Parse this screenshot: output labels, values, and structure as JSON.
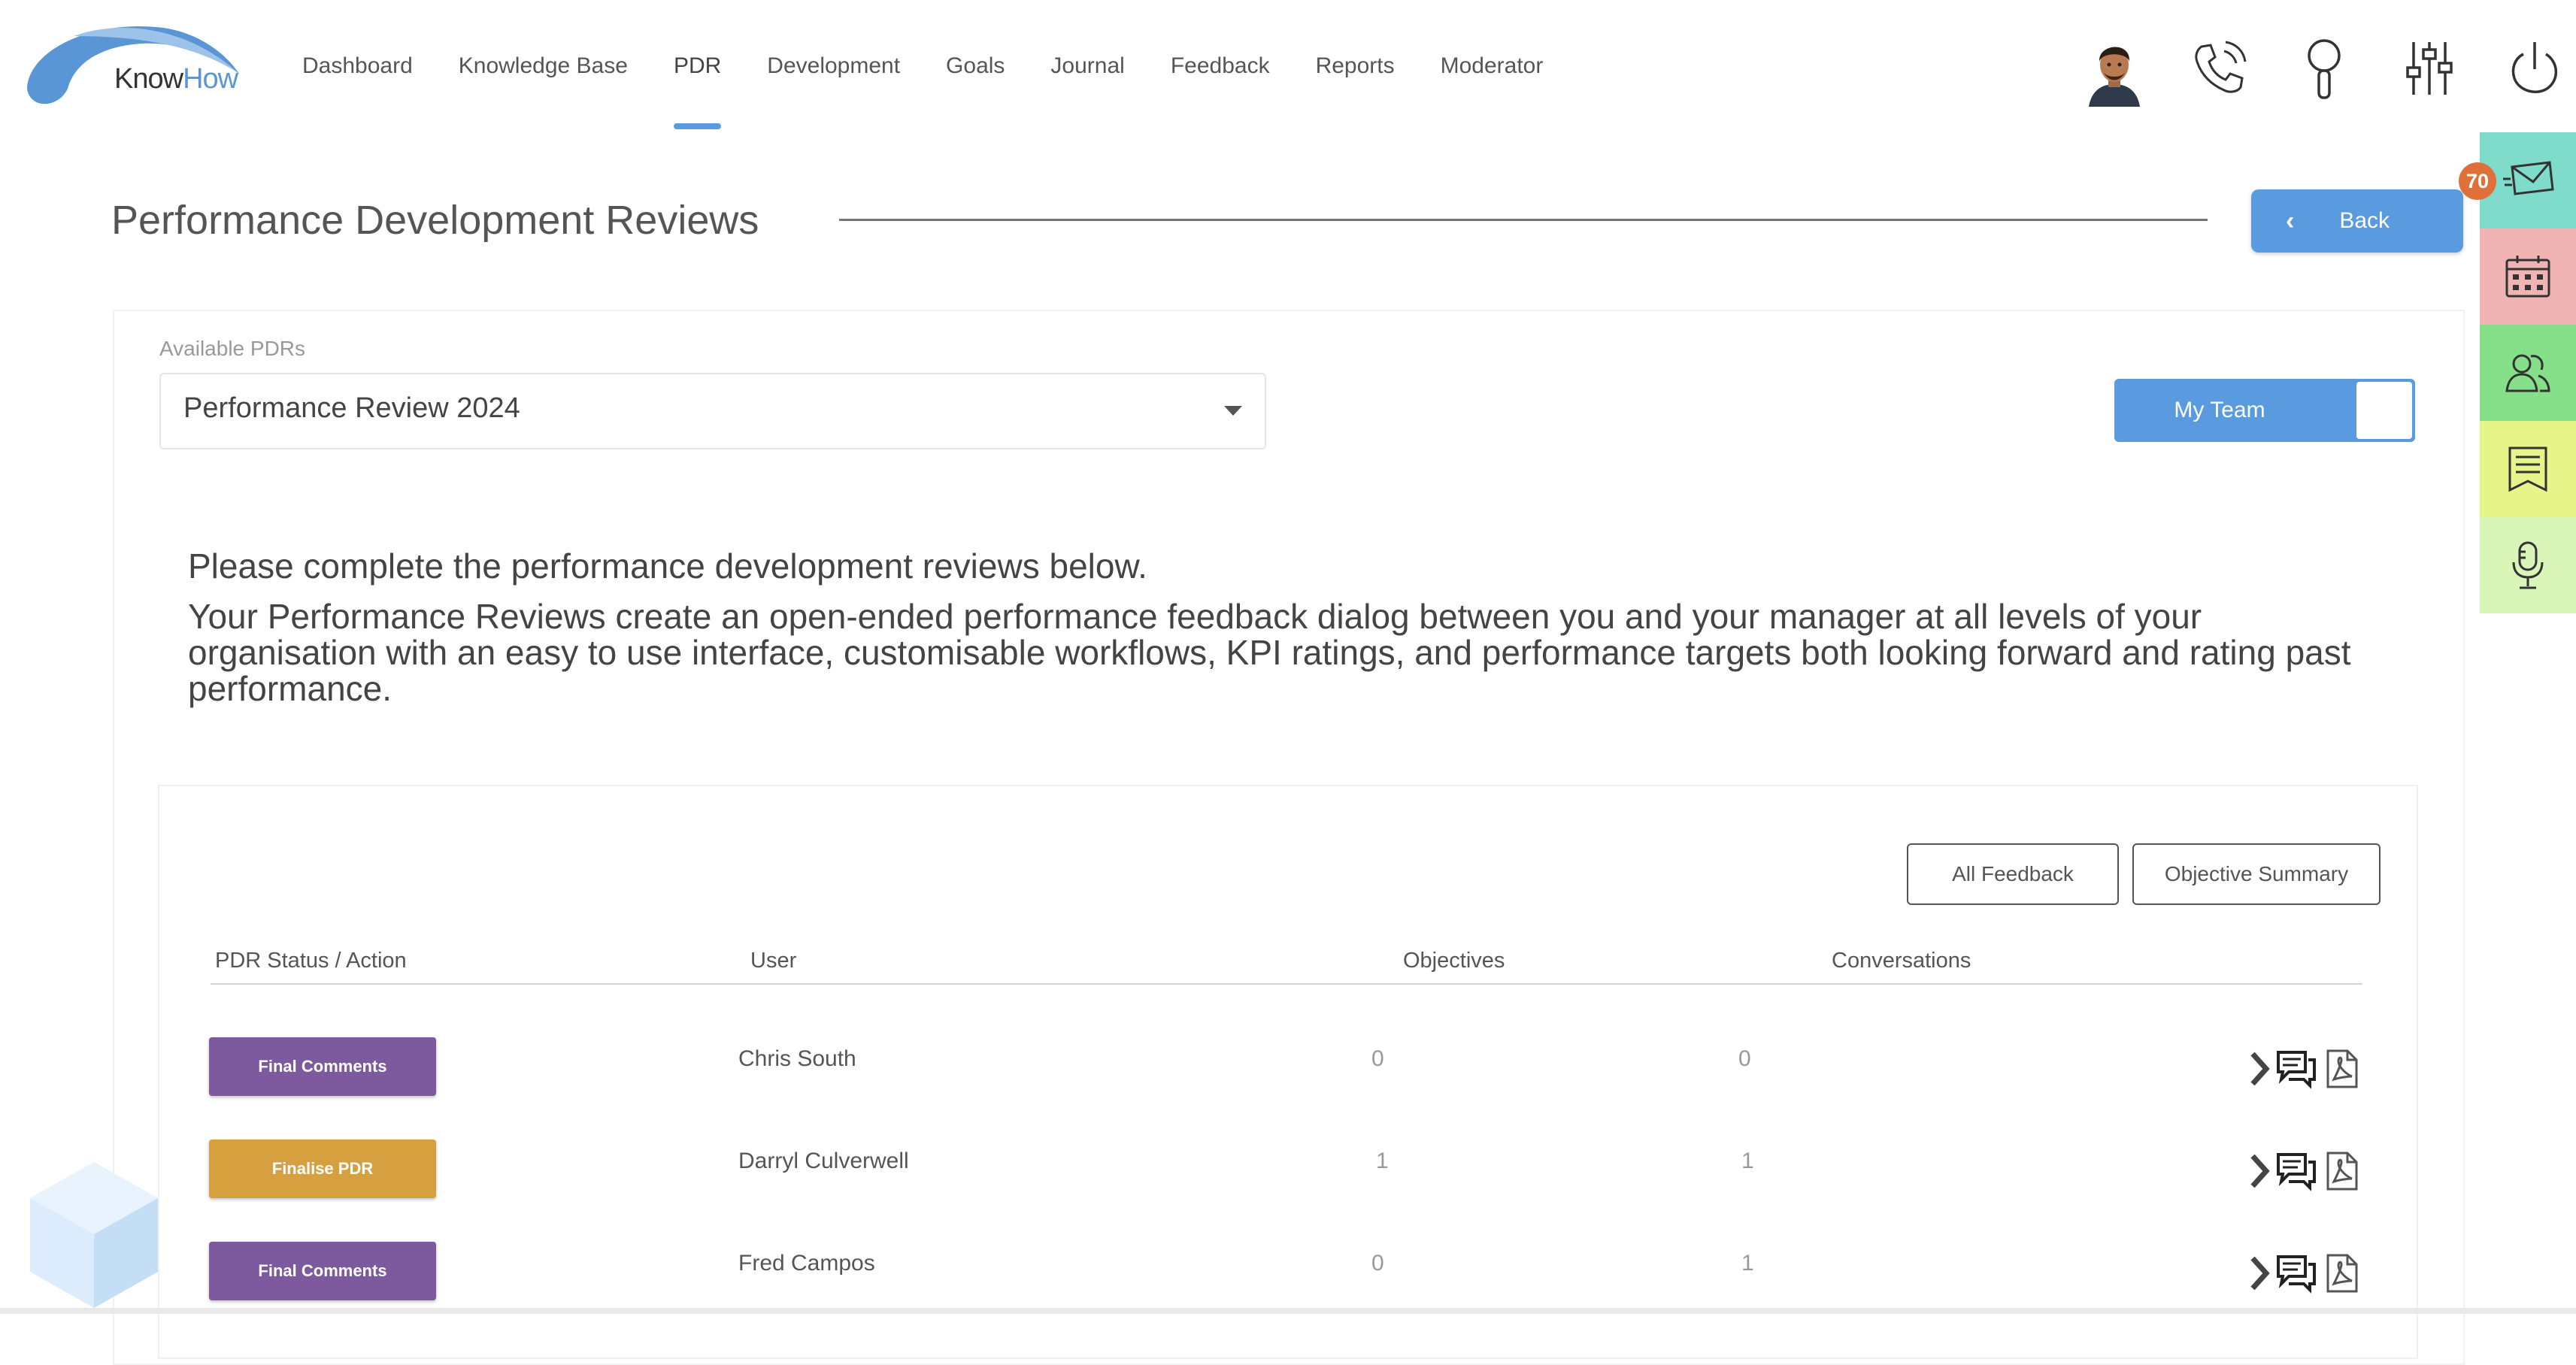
{
  "brand": {
    "logo_text_a": "Know",
    "logo_text_b": "How",
    "accent": "#5a9be0"
  },
  "nav": {
    "items": [
      {
        "label": "Dashboard"
      },
      {
        "label": "Knowledge Base"
      },
      {
        "label": "PDR",
        "active": true
      },
      {
        "label": "Development"
      },
      {
        "label": "Goals"
      },
      {
        "label": "Journal"
      },
      {
        "label": "Feedback"
      },
      {
        "label": "Reports"
      },
      {
        "label": "Moderator"
      }
    ]
  },
  "header_icons": [
    "avatar",
    "phone-icon",
    "search-icon",
    "settings-sliders-icon",
    "power-icon"
  ],
  "dock": {
    "items": [
      {
        "icon": "mail-icon",
        "color": "#7fdccb"
      },
      {
        "icon": "calendar-icon",
        "color": "#f0b4b4"
      },
      {
        "icon": "users-icon",
        "color": "#86e08a"
      },
      {
        "icon": "notes-icon",
        "color": "#e6f58a"
      },
      {
        "icon": "microphone-icon",
        "color": "#d9f5b8"
      }
    ],
    "mail_badge": "70",
    "badge_color": "#e0703a"
  },
  "page": {
    "title": "Performance Development Reviews",
    "back_label": "Back"
  },
  "pdr_select": {
    "label": "Available PDRs",
    "value": "Performance Review 2024"
  },
  "team_toggle": {
    "label": "My Team"
  },
  "intro": {
    "line1": "Please complete the performance development reviews below.",
    "line2": "Your Performance Reviews create an open-ended performance feedback dialog between you and your manager at all levels of your organisation with an easy to use interface, customisable workflows, KPI ratings, and performance targets both looking forward and rating past performance."
  },
  "table": {
    "buttons": {
      "all_feedback": "All Feedback",
      "objective_summary": "Objective Summary"
    },
    "headers": {
      "status": "PDR Status / Action",
      "user": "User",
      "objectives": "Objectives",
      "conversations": "Conversations"
    },
    "rows": [
      {
        "status": "Final Comments",
        "status_color": "#7d5a9e",
        "user": "Chris South",
        "objectives": "0",
        "conversations": "0"
      },
      {
        "status": "Finalise PDR",
        "status_color": "#d6a040",
        "user": "Darryl Culverwell",
        "objectives": "1",
        "conversations": "1"
      },
      {
        "status": "Final Comments",
        "status_color": "#7d5a9e",
        "user": "Fred Campos",
        "objectives": "0",
        "conversations": "1"
      }
    ]
  }
}
